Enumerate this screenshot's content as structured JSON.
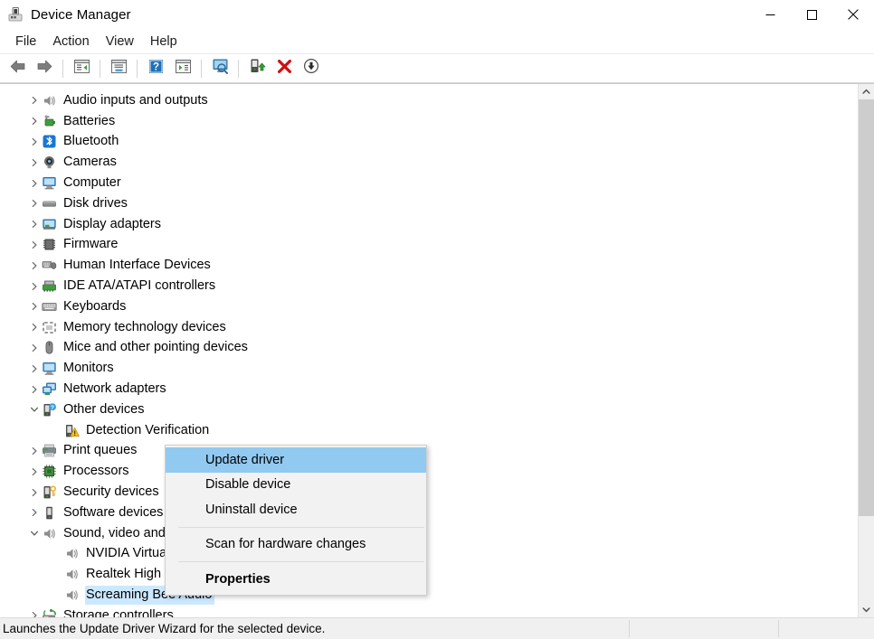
{
  "window": {
    "title": "Device Manager",
    "icon": "device-manager-icon",
    "controls": {
      "minimize": "minimize-icon",
      "maximize": "maximize-icon",
      "close": "close-icon"
    }
  },
  "menubar": {
    "items": [
      {
        "label": "File",
        "name": "menu-file"
      },
      {
        "label": "Action",
        "name": "menu-action"
      },
      {
        "label": "View",
        "name": "menu-view"
      },
      {
        "label": "Help",
        "name": "menu-help"
      }
    ]
  },
  "toolbar": {
    "buttons": [
      {
        "name": "back-button",
        "icon": "back-arrow-icon"
      },
      {
        "name": "forward-button",
        "icon": "forward-arrow-icon"
      },
      {
        "sep": true
      },
      {
        "name": "show-hide-console-tree-button",
        "icon": "console-tree-icon"
      },
      {
        "sep": true
      },
      {
        "name": "properties-button",
        "icon": "properties-window-icon"
      },
      {
        "sep": true
      },
      {
        "name": "help-button",
        "icon": "question-mark-icon"
      },
      {
        "name": "show-hide-action-pane-button",
        "icon": "action-pane-icon"
      },
      {
        "sep": true
      },
      {
        "name": "scan-for-hardware-changes-button",
        "icon": "monitor-scan-icon"
      },
      {
        "sep": true
      },
      {
        "name": "update-driver-button",
        "icon": "update-driver-icon"
      },
      {
        "name": "uninstall-device-button",
        "icon": "red-x-icon"
      },
      {
        "name": "disable-device-button",
        "icon": "down-arrow-circle-icon"
      }
    ]
  },
  "tree": {
    "nodes": [
      {
        "label": "Audio inputs and outputs",
        "icon": "speaker-icon",
        "expander": "collapsed",
        "indent": 0,
        "selected": false
      },
      {
        "label": "Batteries",
        "icon": "battery-icon",
        "expander": "collapsed",
        "indent": 0,
        "selected": false
      },
      {
        "label": "Bluetooth",
        "icon": "bluetooth-icon",
        "expander": "collapsed",
        "indent": 0,
        "selected": false
      },
      {
        "label": "Cameras",
        "icon": "camera-icon",
        "expander": "collapsed",
        "indent": 0,
        "selected": false
      },
      {
        "label": "Computer",
        "icon": "computer-icon",
        "expander": "collapsed",
        "indent": 0,
        "selected": false
      },
      {
        "label": "Disk drives",
        "icon": "disk-drive-icon",
        "expander": "collapsed",
        "indent": 0,
        "selected": false
      },
      {
        "label": "Display adapters",
        "icon": "display-adapter-icon",
        "expander": "collapsed",
        "indent": 0,
        "selected": false
      },
      {
        "label": "Firmware",
        "icon": "firmware-chip-icon",
        "expander": "collapsed",
        "indent": 0,
        "selected": false
      },
      {
        "label": "Human Interface Devices",
        "icon": "hid-icon",
        "expander": "collapsed",
        "indent": 0,
        "selected": false
      },
      {
        "label": "IDE ATA/ATAPI controllers",
        "icon": "ide-controller-icon",
        "expander": "collapsed",
        "indent": 0,
        "selected": false
      },
      {
        "label": "Keyboards",
        "icon": "keyboard-icon",
        "expander": "collapsed",
        "indent": 0,
        "selected": false
      },
      {
        "label": "Memory technology devices",
        "icon": "memory-device-icon",
        "expander": "collapsed",
        "indent": 0,
        "selected": false
      },
      {
        "label": "Mice and other pointing devices",
        "icon": "mouse-icon",
        "expander": "collapsed",
        "indent": 0,
        "selected": false
      },
      {
        "label": "Monitors",
        "icon": "monitor-icon",
        "expander": "collapsed",
        "indent": 0,
        "selected": false
      },
      {
        "label": "Network adapters",
        "icon": "network-adapter-icon",
        "expander": "collapsed",
        "indent": 0,
        "selected": false
      },
      {
        "label": "Other devices",
        "icon": "unknown-device-icon",
        "expander": "expanded",
        "indent": 0,
        "selected": false
      },
      {
        "label": "Detection Verification",
        "icon": "warning-device-icon",
        "expander": "none",
        "indent": 1,
        "selected": false
      },
      {
        "label": "Print queues",
        "icon": "printer-icon",
        "expander": "collapsed",
        "indent": 0,
        "selected": false
      },
      {
        "label": "Processors",
        "icon": "processor-icon",
        "expander": "collapsed",
        "indent": 0,
        "selected": false
      },
      {
        "label": "Security devices",
        "icon": "security-device-icon",
        "expander": "collapsed",
        "indent": 0,
        "selected": false
      },
      {
        "label": "Software devices",
        "icon": "software-device-icon",
        "expander": "collapsed",
        "indent": 0,
        "selected": false
      },
      {
        "label": "Sound, video and game controllers",
        "icon": "speaker-icon",
        "expander": "expanded",
        "indent": 0,
        "selected": false
      },
      {
        "label": "NVIDIA Virtual Audio Device (Wave Extensible) (WDM)",
        "icon": "speaker-icon",
        "expander": "none",
        "indent": 1,
        "selected": false
      },
      {
        "label": "Realtek High Definition Audio",
        "icon": "speaker-icon",
        "expander": "none",
        "indent": 1,
        "selected": false
      },
      {
        "label": "Screaming Bee Audio",
        "icon": "speaker-icon",
        "expander": "none",
        "indent": 1,
        "selected": true
      },
      {
        "label": "Storage controllers",
        "icon": "storage-controller-icon",
        "expander": "collapsed",
        "indent": 0,
        "selected": false
      }
    ]
  },
  "context_menu": {
    "items": [
      {
        "label": "Update driver",
        "name": "ctx-update-driver",
        "highlight": true,
        "bold": false,
        "sep_after": false
      },
      {
        "label": "Disable device",
        "name": "ctx-disable-device",
        "highlight": false,
        "bold": false,
        "sep_after": false
      },
      {
        "label": "Uninstall device",
        "name": "ctx-uninstall-device",
        "highlight": false,
        "bold": false,
        "sep_after": true
      },
      {
        "label": "Scan for hardware changes",
        "name": "ctx-scan-for-hardware-changes",
        "highlight": false,
        "bold": false,
        "sep_after": true
      },
      {
        "label": "Properties",
        "name": "ctx-properties",
        "highlight": false,
        "bold": true,
        "sep_after": false
      }
    ]
  },
  "statusbar": {
    "text": "Launches the Update Driver Wizard for the selected device."
  },
  "scrollbar": {
    "up_arrow": "chevron-up-icon",
    "down_arrow": "chevron-down-icon",
    "thumb_top_pct": 0,
    "thumb_height_pct": 83
  },
  "colors": {
    "selection": "#cce8ff",
    "menu_highlight": "#91c9f0",
    "accent_green": "#4caf50",
    "warning_yellow": "#ffc20e",
    "error_red": "#cc0000"
  }
}
